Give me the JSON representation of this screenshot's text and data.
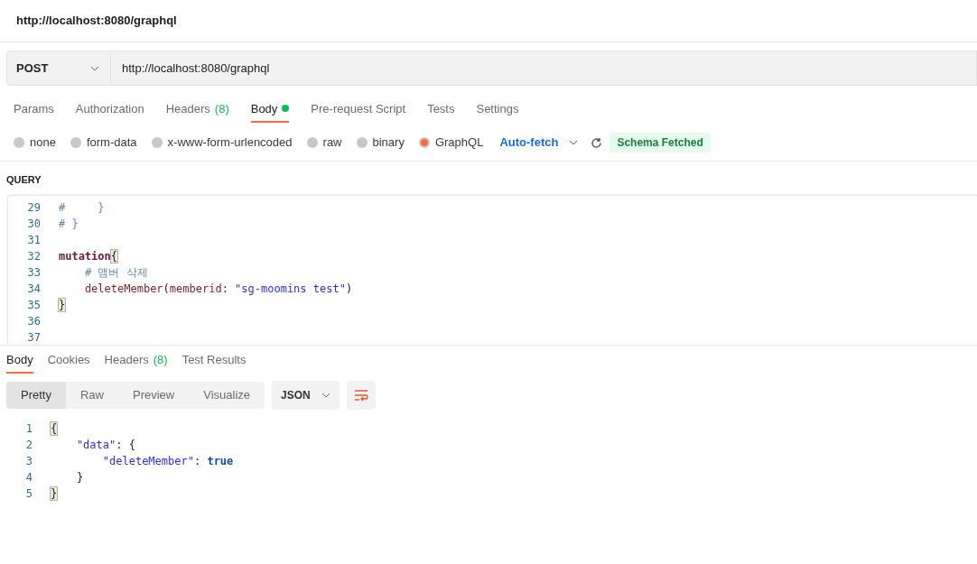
{
  "title": "http://localhost:8080/graphql",
  "request": {
    "method": "POST",
    "url": "http://localhost:8080/graphql"
  },
  "request_tabs": [
    {
      "label": "Params",
      "selected": false
    },
    {
      "label": "Authorization",
      "selected": false
    },
    {
      "label": "Headers",
      "count": "(8)",
      "selected": false
    },
    {
      "label": "Body",
      "selected": true,
      "dot": true
    },
    {
      "label": "Pre-request Script",
      "selected": false
    },
    {
      "label": "Tests",
      "selected": false
    },
    {
      "label": "Settings",
      "selected": false
    }
  ],
  "body_types": [
    {
      "label": "none",
      "selected": false
    },
    {
      "label": "form-data",
      "selected": false
    },
    {
      "label": "x-www-form-urlencoded",
      "selected": false
    },
    {
      "label": "raw",
      "selected": false
    },
    {
      "label": "binary",
      "selected": false
    },
    {
      "label": "GraphQL",
      "selected": true
    }
  ],
  "auto_fetch": "Auto-fetch",
  "schema_status": "Schema Fetched",
  "query_label": "QUERY",
  "query_lines": [
    {
      "number": "29",
      "tokens": [
        {
          "kind": "comment",
          "text": "#     }"
        }
      ]
    },
    {
      "number": "30",
      "tokens": [
        {
          "kind": "comment",
          "text": "# }"
        }
      ]
    },
    {
      "number": "31"
    },
    {
      "number": "32",
      "tokens": [
        {
          "kind": "keyword",
          "text": "mutation"
        },
        {
          "kind": "bracket",
          "text": "{"
        }
      ]
    },
    {
      "number": "33",
      "tokens": [
        {
          "kind": "comment",
          "text": "    # 맴버 삭제"
        }
      ]
    },
    {
      "number": "34",
      "tokens": [
        {
          "kind": "field",
          "text": "    deleteMember"
        },
        {
          "kind": "plain",
          "text": "("
        },
        {
          "kind": "field",
          "text": "memberid"
        },
        {
          "kind": "plain",
          "text": ":"
        },
        {
          "kind": "string",
          "text": " \"sg-moomins test\""
        },
        {
          "kind": "plain",
          "text": ")"
        }
      ]
    },
    {
      "number": "35",
      "tokens": [
        {
          "kind": "bracket",
          "text": "}"
        }
      ]
    },
    {
      "number": "36"
    },
    {
      "number": "37"
    }
  ],
  "response_tabs": [
    {
      "label": "Body",
      "selected": true
    },
    {
      "label": "Cookies",
      "selected": false
    },
    {
      "label": "Headers",
      "count": "(8)",
      "selected": false
    },
    {
      "label": "Test Results",
      "selected": false
    }
  ],
  "view_modes": [
    {
      "label": "Pretty",
      "selected": true
    },
    {
      "label": "Raw",
      "selected": false
    },
    {
      "label": "Preview",
      "selected": false
    },
    {
      "label": "Visualize",
      "selected": false
    }
  ],
  "format": "JSON",
  "response_lines": [
    {
      "number": "1",
      "tokens": [
        {
          "kind": "bracket",
          "text": "{"
        }
      ]
    },
    {
      "number": "2",
      "tokens": [
        {
          "kind": "string",
          "text": "    \"data\""
        },
        {
          "kind": "plain",
          "text": ": {"
        }
      ]
    },
    {
      "number": "3",
      "tokens": [
        {
          "kind": "string",
          "text": "        \"deleteMember\""
        },
        {
          "kind": "plain",
          "text": ": "
        },
        {
          "kind": "bool",
          "text": "true"
        }
      ]
    },
    {
      "number": "4",
      "tokens": [
        {
          "kind": "plain",
          "text": "    }"
        }
      ]
    },
    {
      "number": "5",
      "tokens": [
        {
          "kind": "bracket",
          "text": "}"
        }
      ]
    }
  ]
}
